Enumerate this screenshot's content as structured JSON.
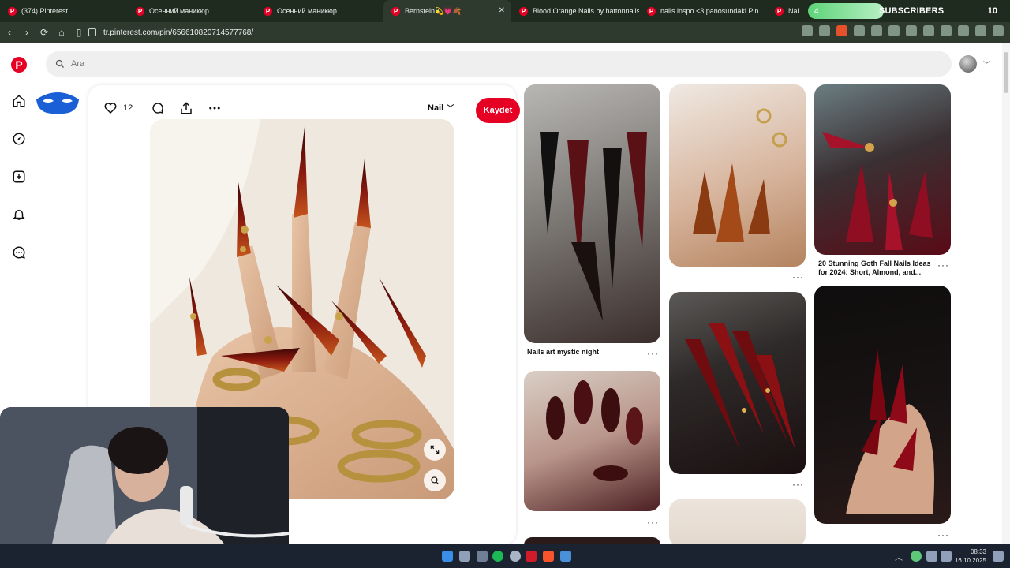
{
  "browser": {
    "tabs": [
      {
        "title": "(374) Pinterest",
        "active": false
      },
      {
        "title": "Осенний маникюр",
        "active": false
      },
      {
        "title": "Осенний маникюр",
        "active": false
      },
      {
        "title": "Bernstein💫💗🍂",
        "active": true
      },
      {
        "title": "Blood Orange Nails by hattonnails o",
        "active": false
      },
      {
        "title": "nails inspo <3 panosundaki Pin",
        "active": false
      },
      {
        "title": "Nails e",
        "active": false
      }
    ],
    "overlay": {
      "goal_value": "4",
      "label": "SUBSCRIBERS",
      "count": "10"
    },
    "url": "tr.pinterest.com/pin/656610820714577768/"
  },
  "pinterest": {
    "search_placeholder": "Ara",
    "pin": {
      "likes": "12",
      "board": "Nail",
      "save_label": "Kaydet"
    },
    "captions": [
      {
        "id": "c1",
        "text": "Nails art mystic night"
      },
      {
        "id": "c2",
        "text": "20 Stunning Goth Fall Nails Ideas for 2024: Short, Almond, and..."
      }
    ]
  },
  "taskbar": {
    "time": "08:33",
    "date": "16.10.2025"
  },
  "colors": {
    "pinterest_red": "#e60023",
    "chrome_dark": "#1f2b1f"
  }
}
